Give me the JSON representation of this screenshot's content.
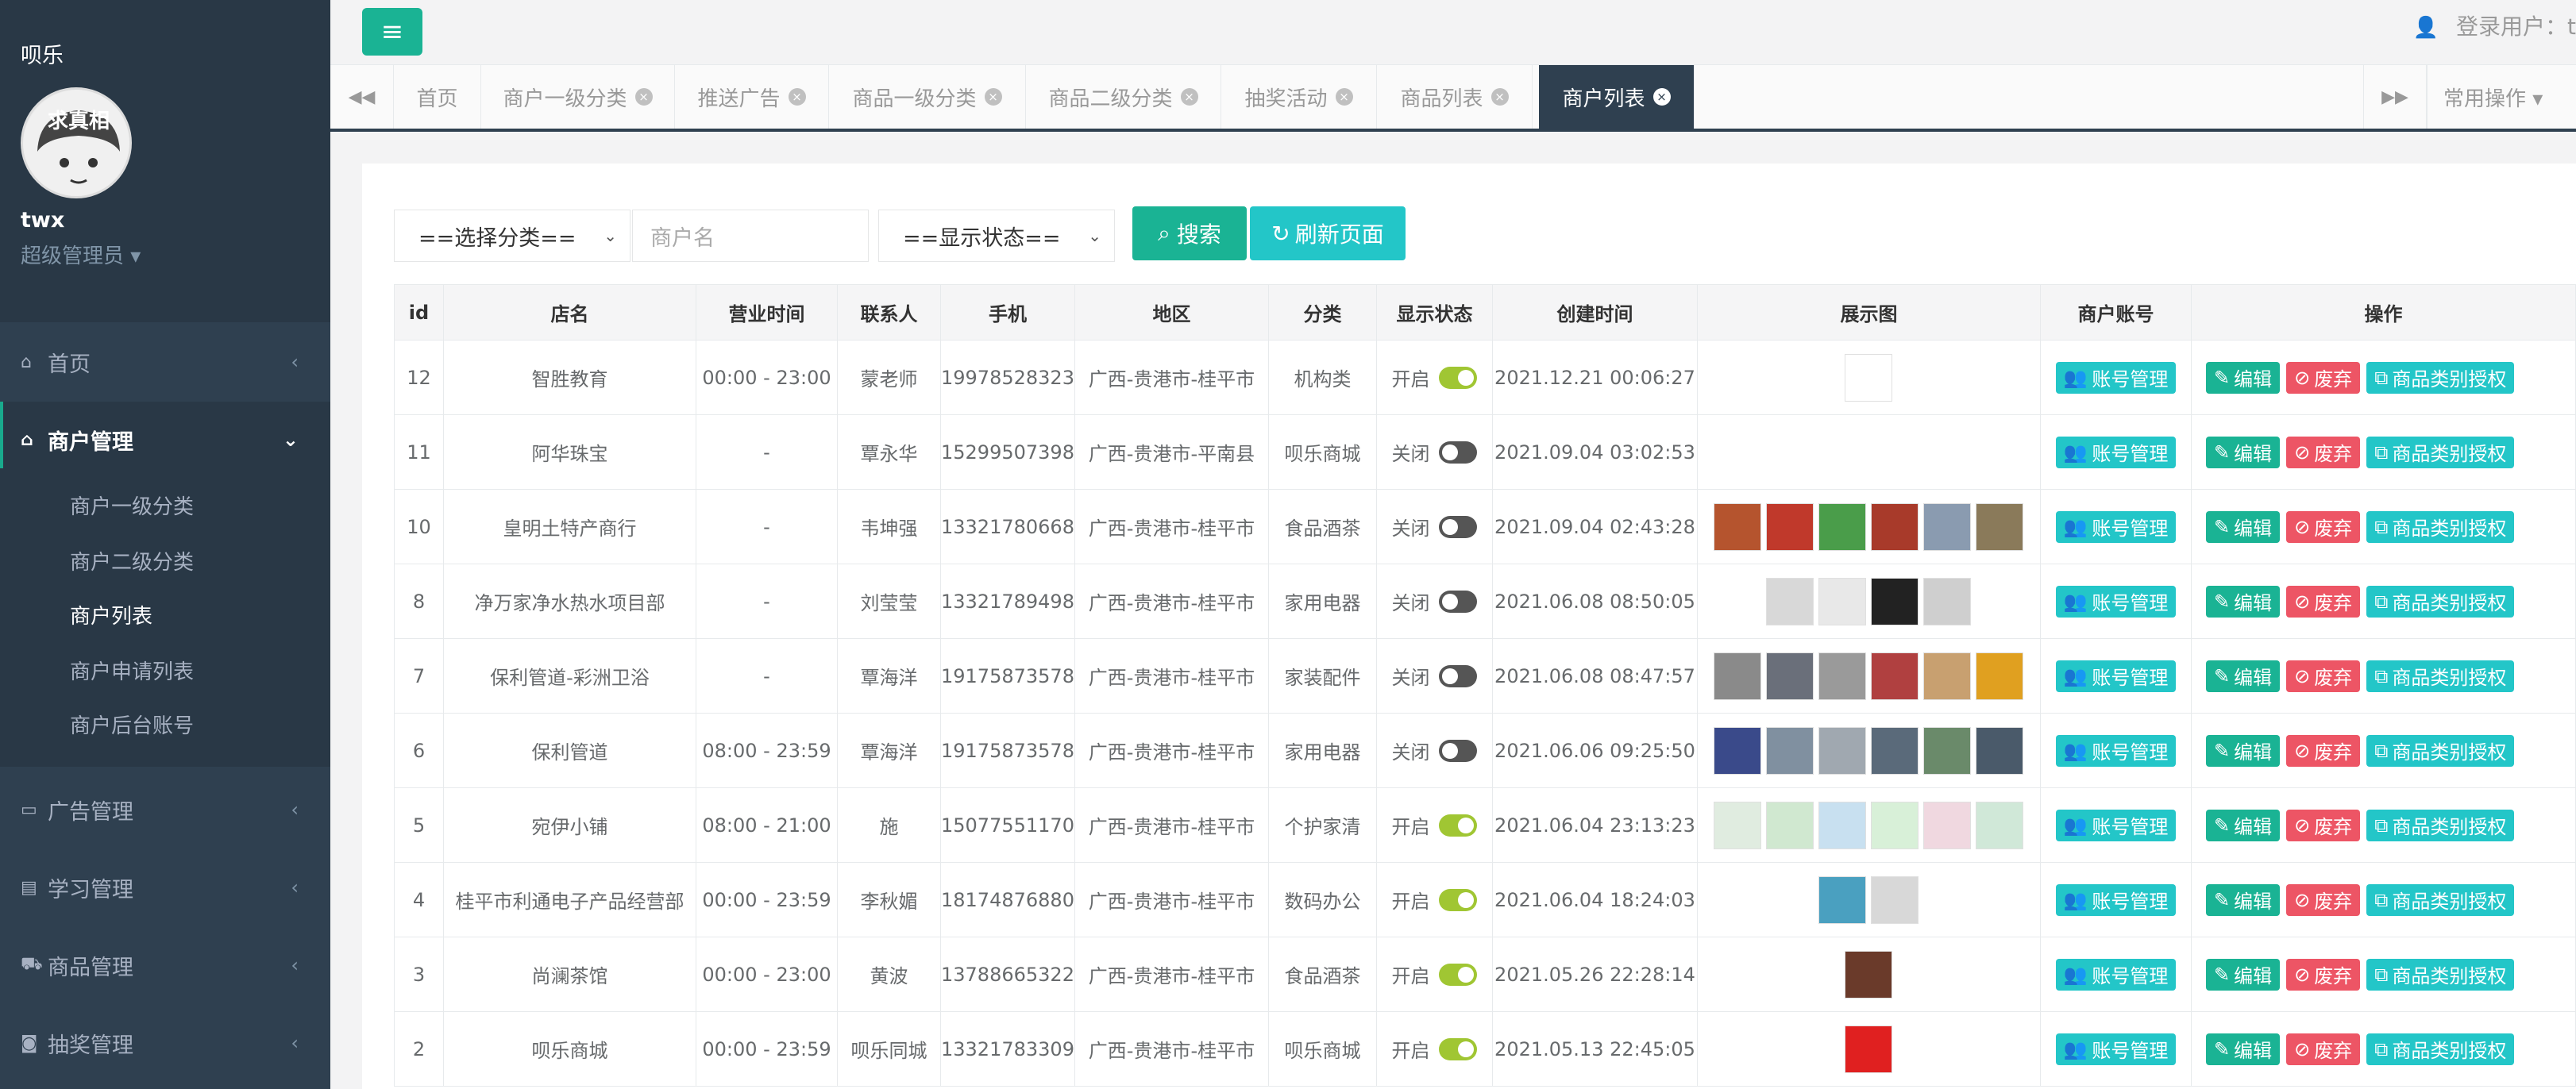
{
  "app": {
    "title": "呗乐"
  },
  "user": {
    "name": "twx",
    "role": "超级管理员 ▾",
    "avatar_text": "求真相",
    "login_label": "登录用户：t"
  },
  "sidebar": {
    "items": [
      {
        "label": "首页",
        "icon": "home-icon",
        "glyph": "⌂"
      },
      {
        "label": "商户管理",
        "icon": "home-icon",
        "glyph": "⌂"
      },
      {
        "label": "广告管理",
        "icon": "monitor-icon",
        "glyph": "▭"
      },
      {
        "label": "学习管理",
        "icon": "book-icon",
        "glyph": "▤"
      },
      {
        "label": "商品管理",
        "icon": "cart-icon",
        "glyph": "⛟"
      },
      {
        "label": "抽奖管理",
        "icon": "money-icon",
        "glyph": "◙"
      }
    ],
    "submenu": [
      "商户一级分类",
      "商户二级分类",
      "商户列表",
      "商户申请列表",
      "商户后台账号"
    ]
  },
  "tabs": [
    "首页",
    "商户一级分类",
    "推送广告",
    "商品一级分类",
    "商品二级分类",
    "抽奖活动",
    "商品列表",
    "商户列表"
  ],
  "common_ops": "常用操作 ▾",
  "filters": {
    "category": "==选择分类==",
    "name_placeholder": "商户名",
    "status": "==显示状态==",
    "search": "搜索",
    "refresh": "刷新页面"
  },
  "table": {
    "columns": [
      "id",
      "店名",
      "营业时间",
      "联系人",
      "手机",
      "地区",
      "分类",
      "显示状态",
      "创建时间",
      "展示图",
      "商户账号",
      "操作"
    ],
    "row_buttons": {
      "account": "账号管理",
      "edit": "编辑",
      "drop": "废弃",
      "auth": "商品类别授权"
    },
    "rows": [
      {
        "id": "12",
        "name": "智胜教育",
        "hours": "00:00 - 23:00",
        "contact": "蒙老师",
        "phone": "19978528323",
        "region": "广西-贵港市-桂平市",
        "category": "机构类",
        "status": "开启",
        "on": true,
        "created": "2021.12.21 00:06:27",
        "images": [
          "#ffffff"
        ]
      },
      {
        "id": "11",
        "name": "阿华珠宝",
        "hours": "-",
        "contact": "覃永华",
        "phone": "15299507398",
        "region": "广西-贵港市-平南县",
        "category": "呗乐商城",
        "status": "关闭",
        "on": false,
        "created": "2021.09.04 03:02:53",
        "images": []
      },
      {
        "id": "10",
        "name": "皇明土特产商行",
        "hours": "-",
        "contact": "韦坤强",
        "phone": "13321780668",
        "region": "广西-贵港市-桂平市",
        "category": "食品酒茶",
        "status": "关闭",
        "on": false,
        "created": "2021.09.04 02:43:28",
        "images": [
          "#b5542e",
          "#c0392b",
          "#4a9d4a",
          "#a83a2a",
          "#8a9bb0",
          "#8a7a5a"
        ]
      },
      {
        "id": "8",
        "name": "净万家净水热水项目部",
        "hours": "-",
        "contact": "刘莹莹",
        "phone": "13321789498",
        "region": "广西-贵港市-桂平市",
        "category": "家用电器",
        "status": "关闭",
        "on": false,
        "created": "2021.06.08 08:50:05",
        "images": [
          "#d8d8d8",
          "#e8e8e8",
          "#222222",
          "#cfcfcf"
        ]
      },
      {
        "id": "7",
        "name": "保利管道-彩洲卫浴",
        "hours": "-",
        "contact": "覃海洋",
        "phone": "19175873578",
        "region": "广西-贵港市-桂平市",
        "category": "家装配件",
        "status": "关闭",
        "on": false,
        "created": "2021.06.08 08:47:57",
        "images": [
          "#8a8a8a",
          "#6a6f7a",
          "#9a9a9a",
          "#b04040",
          "#c8a070",
          "#e0a020"
        ]
      },
      {
        "id": "6",
        "name": "保利管道",
        "hours": "08:00 - 23:59",
        "contact": "覃海洋",
        "phone": "19175873578",
        "region": "广西-贵港市-桂平市",
        "category": "家用电器",
        "status": "关闭",
        "on": false,
        "created": "2021.06.06 09:25:50",
        "images": [
          "#3a4a8a",
          "#8090a0",
          "#a0a8b0",
          "#5a6a7a",
          "#6a8a6a",
          "#4a5a6a"
        ]
      },
      {
        "id": "5",
        "name": "宛伊小铺",
        "hours": "08:00 - 21:00",
        "contact": "施",
        "phone": "15077551170",
        "region": "广西-贵港市-桂平市",
        "category": "个护家清",
        "status": "开启",
        "on": true,
        "created": "2021.06.04 23:13:23",
        "images": [
          "#e0ece0",
          "#d0e8d0",
          "#c8e0f0",
          "#d8f0d8",
          "#f0d8e0",
          "#d0e8d8"
        ]
      },
      {
        "id": "4",
        "name": "桂平市利通电子产品经营部",
        "hours": "00:00 - 23:59",
        "contact": "李秋媚",
        "phone": "18174876880",
        "region": "广西-贵港市-桂平市",
        "category": "数码办公",
        "status": "开启",
        "on": true,
        "created": "2021.06.04 18:24:03",
        "images": [
          "#4aa0c0",
          "#d8d8d8"
        ]
      },
      {
        "id": "3",
        "name": "尚澜茶馆",
        "hours": "00:00 - 23:00",
        "contact": "黄波",
        "phone": "13788665322",
        "region": "广西-贵港市-桂平市",
        "category": "食品酒茶",
        "status": "开启",
        "on": true,
        "created": "2021.05.26 22:28:14",
        "images": [
          "#6a3a2a"
        ]
      },
      {
        "id": "2",
        "name": "呗乐商城",
        "hours": "00:00 - 23:59",
        "contact": "呗乐同城",
        "phone": "13321783309",
        "region": "广西-贵港市-桂平市",
        "category": "呗乐商城",
        "status": "开启",
        "on": true,
        "created": "2021.05.13 22:45:05",
        "images": [
          "#e02020"
        ]
      }
    ]
  }
}
